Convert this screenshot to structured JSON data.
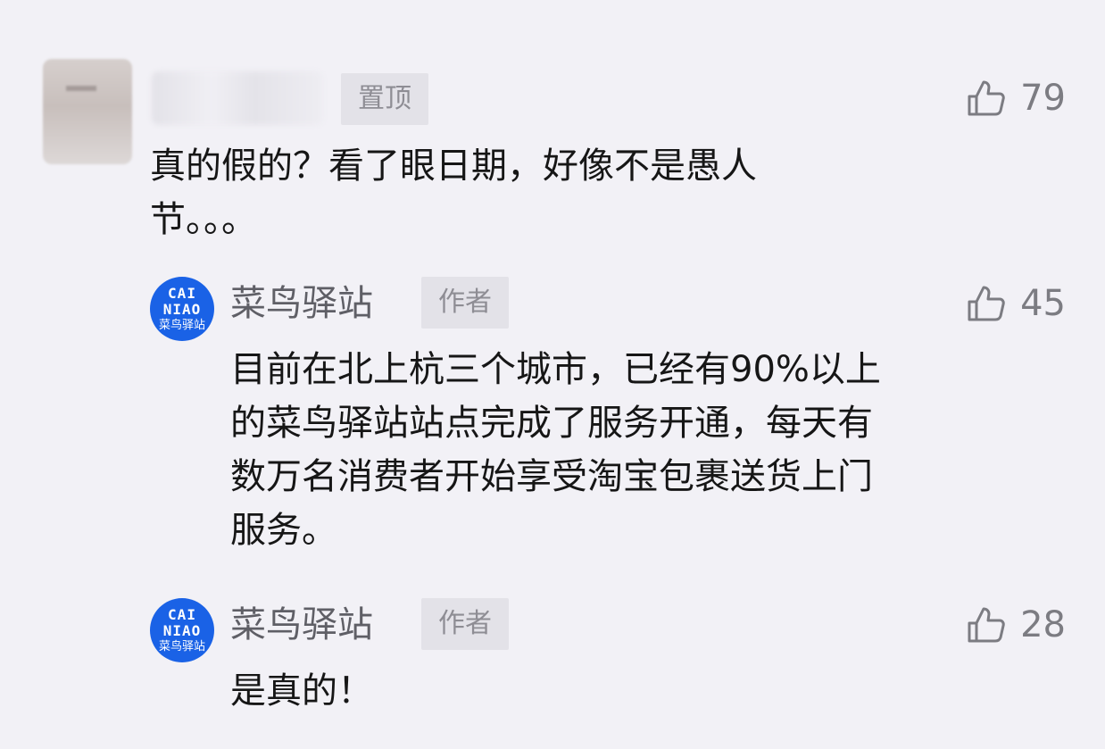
{
  "comments": [
    {
      "pinned_label": "置顶",
      "like_count": "79",
      "text": "真的假的？看了眼日期，好像不是愚人\n节。。。"
    }
  ],
  "replies": [
    {
      "author": "菜鸟驿站",
      "avatar_line1": "CAI",
      "avatar_line2": "NIAO",
      "avatar_cn": "菜鸟驿站",
      "badge": "作者",
      "like_count": "45",
      "text": "目前在北上杭三个城市，已经有90%以上\n的菜鸟驿站站点完成了服务开通，每天有\n数万名消费者开始享受淘宝包裹送货上门\n服务。"
    },
    {
      "author": "菜鸟驿站",
      "avatar_line1": "CAI",
      "avatar_line2": "NIAO",
      "avatar_cn": "菜鸟驿站",
      "badge": "作者",
      "like_count": "28",
      "text": "是真的！"
    }
  ],
  "icons": {
    "like": "thumbs-up-icon",
    "avatar": "cainiao-logo-icon"
  },
  "colors": {
    "background": "#f2f1f6",
    "brand_blue": "#1a62e6",
    "badge_bg": "#e3e2e8",
    "meta_gray": "#7c7c82"
  }
}
